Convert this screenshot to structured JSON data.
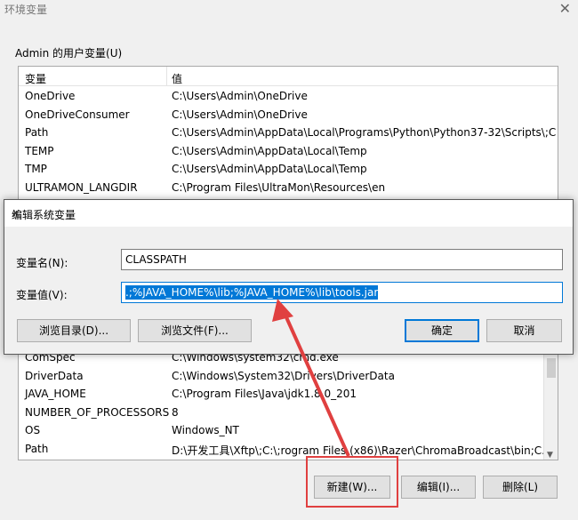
{
  "background_window": {
    "title": "环境变量",
    "close_glyph": "✕",
    "user_group_label": "Admin 的用户变量(U)",
    "column_variable": "变量",
    "column_value": "值",
    "user_vars": [
      {
        "name": "OneDrive",
        "value": "C:\\Users\\Admin\\OneDrive"
      },
      {
        "name": "OneDriveConsumer",
        "value": "C:\\Users\\Admin\\OneDrive"
      },
      {
        "name": "Path",
        "value": "C:\\Users\\Admin\\AppData\\Local\\Programs\\Python\\Python37-32\\Scripts\\;C..."
      },
      {
        "name": "TEMP",
        "value": "C:\\Users\\Admin\\AppData\\Local\\Temp"
      },
      {
        "name": "TMP",
        "value": "C:\\Users\\Admin\\AppData\\Local\\Temp"
      },
      {
        "name": "ULTRAMON_LANGDIR",
        "value": "C:\\Program Files\\UltraMon\\Resources\\en"
      }
    ],
    "system_vars": [
      {
        "name": "ComSpec",
        "value": "C:\\Windows\\system32\\cmd.exe"
      },
      {
        "name": "DriverData",
        "value": "C:\\Windows\\System32\\Drivers\\DriverData"
      },
      {
        "name": "JAVA_HOME",
        "value": "C:\\Program Files\\Java\\jdk1.8.0_201"
      },
      {
        "name": "NUMBER_OF_PROCESSORS",
        "value": "8"
      },
      {
        "name": "OS",
        "value": "Windows_NT"
      },
      {
        "name": "Path",
        "value": "D:\\开发工具\\Xftp\\;C:\\;rogram Files (x86)\\Razer\\ChromaBroadcast\\bin;C..."
      }
    ],
    "buttons": {
      "new": "新建(W)...",
      "edit": "编辑(I)...",
      "delete": "删除(L)"
    }
  },
  "dialog": {
    "title": "编辑系统变量",
    "close_glyph": "✕",
    "name_label": "变量名(N):",
    "name_value": "CLASSPATH",
    "value_label": "变量值(V):",
    "value_value": ".;%JAVA_HOME%\\lib;%JAVA_HOME%\\lib\\tools.jar",
    "buttons": {
      "browse_dir": "浏览目录(D)...",
      "browse_file": "浏览文件(F)...",
      "ok": "确定",
      "cancel": "取消"
    }
  },
  "colors": {
    "accent": "#0078d7",
    "annotation": "#e04040"
  }
}
